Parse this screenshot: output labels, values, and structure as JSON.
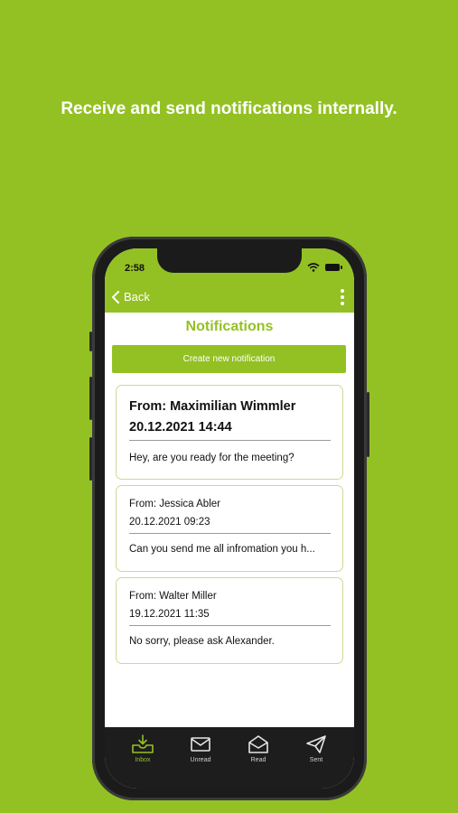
{
  "headline": "Receive and send notifications internally.",
  "status_bar": {
    "time": "2:58"
  },
  "nav": {
    "back_label": "Back"
  },
  "page": {
    "title": "Notifications",
    "create_button_label": "Create new notification"
  },
  "notifications": [
    {
      "from": "From: Maximilian Wimmler",
      "date": "20.12.2021 14:44",
      "message": "Hey, are you ready for the meeting?",
      "unread": true
    },
    {
      "from": "From:  Jessica Abler",
      "date": "20.12.2021 09:23",
      "message": "Can you send me all infromation you h...",
      "unread": false
    },
    {
      "from": "From:  Walter Miller",
      "date": "19.12.2021 11:35",
      "message": "No sorry, please ask Alexander.",
      "unread": false
    }
  ],
  "tabs": [
    {
      "label": "Inbox",
      "icon": "inbox-download-icon",
      "active": true
    },
    {
      "label": "Unread",
      "icon": "envelope-closed-icon",
      "active": false
    },
    {
      "label": "Read",
      "icon": "envelope-open-icon",
      "active": false
    },
    {
      "label": "Sent",
      "icon": "paper-plane-icon",
      "active": false
    }
  ],
  "colors": {
    "brand_green": "#93c123",
    "tab_bar": "#1d1d1d",
    "card_border": "#c9dc93"
  }
}
